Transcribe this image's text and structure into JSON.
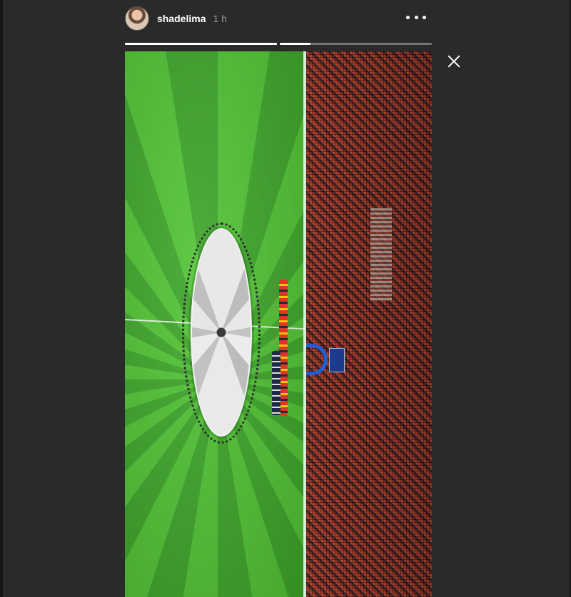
{
  "story": {
    "username": "shadelima",
    "timestamp": "1 h",
    "progress_segments": [
      {
        "filled_fraction": 1.0
      },
      {
        "filled_fraction": 0.2
      }
    ]
  },
  "icons": {
    "more": "more-horizontal-icon",
    "close": "close-icon"
  },
  "colors": {
    "background": "#2a2a2a",
    "pitch_green": "#4cb833",
    "crowd_red": "#b8412e",
    "arch_blue": "#1c5fd6"
  }
}
